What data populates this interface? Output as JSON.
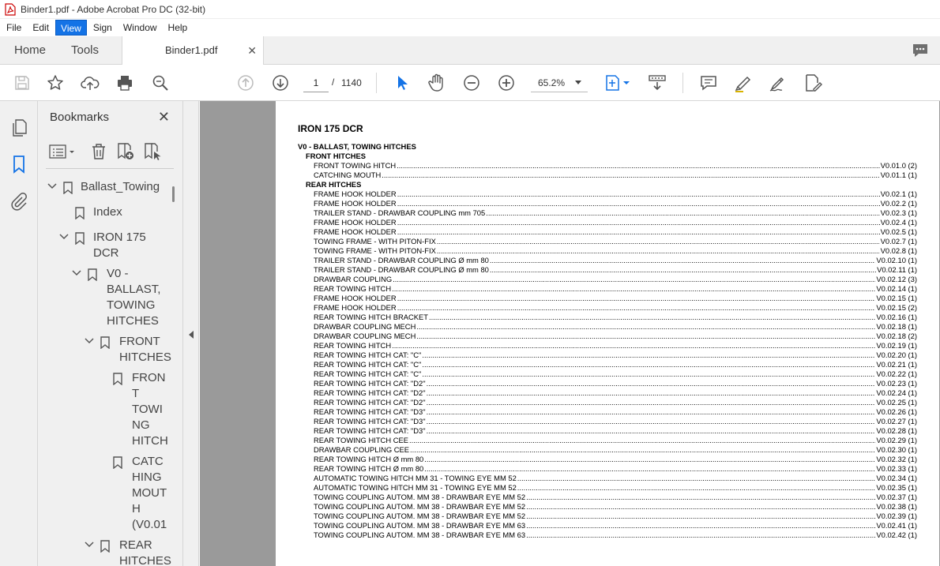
{
  "window": {
    "title": "Binder1.pdf - Adobe Acrobat Pro DC (32-bit)"
  },
  "menu": [
    "File",
    "Edit",
    "View",
    "Sign",
    "Window",
    "Help"
  ],
  "menu_active": "View",
  "tabs": {
    "home": "Home",
    "tools": "Tools",
    "document": "Binder1.pdf"
  },
  "toolbar": {
    "page_current": "1",
    "page_separator": "/",
    "page_total": "1140",
    "zoom": "65.2%"
  },
  "bookmarks": {
    "title": "Bookmarks",
    "tree": {
      "ballast": "Ballast_Towing",
      "index": "Index",
      "iron_l1": "IRON 175",
      "iron_l2": "DCR",
      "v0_l1": "V0 -",
      "v0_l2": "BALLAST,",
      "v0_l3": "TOWING",
      "v0_l4": "HITCHES",
      "front_l1": "FRONT",
      "front_l2": "HITCHES",
      "fth_l1": "FRON",
      "fth_l2": "T",
      "fth_l3": "TOWI",
      "fth_l4": "NG",
      "fth_l5": "HITCH",
      "cm_l1": "CATC",
      "cm_l2": "HING",
      "cm_l3": "MOUT",
      "cm_l4": "H",
      "cm_l5": "(V0.01",
      "rear_l1": "REAR",
      "rear_l2": "HITCHES"
    }
  },
  "document": {
    "title": "IRON 175 DCR",
    "section": "V0 - BALLAST, TOWING HITCHES",
    "groups": [
      {
        "heading": "FRONT HITCHES",
        "entries": [
          {
            "label": "FRONT TOWING HITCH",
            "ref": "V0.01.0 (2)"
          },
          {
            "label": "CATCHING MOUTH",
            "ref": "V0.01.1 (1)"
          }
        ]
      },
      {
        "heading": "REAR HITCHES",
        "entries": [
          {
            "label": "FRAME HOOK HOLDER",
            "ref": "V0.02.1 (1)"
          },
          {
            "label": "FRAME HOOK HOLDER",
            "ref": "V0.02.2 (1)"
          },
          {
            "label": "TRAILER STAND - DRAWBAR COUPLING mm 705",
            "ref": "V0.02.3 (1)"
          },
          {
            "label": "FRAME HOOK HOLDER",
            "ref": "V0.02.4 (1)"
          },
          {
            "label": "FRAME HOOK HOLDER",
            "ref": "V0.02.5 (1)"
          },
          {
            "label": "TOWING FRAME - WITH PITON-FIX",
            "ref": "V0.02.7 (1)"
          },
          {
            "label": "TOWING FRAME - WITH PITON-FIX",
            "ref": "V0.02.8 (1)"
          },
          {
            "label": "TRAILER STAND - DRAWBAR COUPLING Ø mm 80",
            "ref": "V0.02.10 (1)"
          },
          {
            "label": "TRAILER STAND - DRAWBAR COUPLING Ø mm 80",
            "ref": "V0.02.11 (1)"
          },
          {
            "label": "DRAWBAR COUPLING",
            "ref": "V0.02.12 (3)"
          },
          {
            "label": "REAR TOWING HITCH",
            "ref": "V0.02.14 (1)"
          },
          {
            "label": "FRAME HOOK HOLDER",
            "ref": "V0.02.15 (1)"
          },
          {
            "label": "FRAME HOOK HOLDER",
            "ref": "V0.02.15 (2)"
          },
          {
            "label": "REAR TOWING HITCH BRACKET",
            "ref": "V0.02.16 (1)"
          },
          {
            "label": "DRAWBAR COUPLING MECH",
            "ref": "V0.02.18 (1)"
          },
          {
            "label": "DRAWBAR COUPLING MECH",
            "ref": "V0.02.18 (2)"
          },
          {
            "label": "REAR TOWING HITCH",
            "ref": "V0.02.19 (1)"
          },
          {
            "label": "REAR TOWING HITCH CAT: \"C\"",
            "ref": "V0.02.20 (1)"
          },
          {
            "label": "REAR TOWING HITCH CAT: \"C\"",
            "ref": "V0.02.21 (1)"
          },
          {
            "label": "REAR TOWING HITCH CAT: \"C\"",
            "ref": "V0.02.22 (1)"
          },
          {
            "label": "REAR TOWING HITCH CAT: \"D2\"",
            "ref": "V0.02.23 (1)"
          },
          {
            "label": "REAR TOWING HITCH CAT: \"D2\"",
            "ref": "V0.02.24 (1)"
          },
          {
            "label": "REAR TOWING HITCH CAT: \"D2\"",
            "ref": "V0.02.25 (1)"
          },
          {
            "label": "REAR TOWING HITCH CAT: \"D3\"",
            "ref": "V0.02.26 (1)"
          },
          {
            "label": "REAR TOWING HITCH CAT: \"D3\"",
            "ref": "V0.02.27 (1)"
          },
          {
            "label": "REAR TOWING HITCH CAT: \"D3\"",
            "ref": "V0.02.28 (1)"
          },
          {
            "label": "REAR TOWING HITCH CEE",
            "ref": "V0.02.29 (1)"
          },
          {
            "label": "DRAWBAR COUPLING CEE",
            "ref": "V0.02.30 (1)"
          },
          {
            "label": "REAR TOWING HITCH Ø mm 80",
            "ref": "V0.02.32 (1)"
          },
          {
            "label": "REAR TOWING HITCH Ø mm 80",
            "ref": "V0.02.33 (1)"
          },
          {
            "label": "AUTOMATIC TOWING HITCH MM 31 - TOWING EYE MM 52",
            "ref": "V0.02.34 (1)"
          },
          {
            "label": "AUTOMATIC TOWING HITCH MM 31 - TOWING EYE MM 52",
            "ref": "V0.02.35 (1)"
          },
          {
            "label": "TOWING COUPLING AUTOM. MM 38 - DRAWBAR EYE MM 52",
            "ref": "V0.02.37 (1)"
          },
          {
            "label": "TOWING COUPLING AUTOM. MM 38 - DRAWBAR EYE MM 52",
            "ref": "V0.02.38 (1)"
          },
          {
            "label": "TOWING COUPLING AUTOM. MM 38 - DRAWBAR EYE MM 52",
            "ref": "V0.02.39 (1)"
          },
          {
            "label": "TOWING COUPLING AUTOM. MM 38 - DRAWBAR EYE MM 63",
            "ref": "V0.02.41 (1)"
          },
          {
            "label": "TOWING COUPLING AUTOM. MM 38 - DRAWBAR EYE MM 63",
            "ref": "V0.02.42 (1)"
          }
        ]
      }
    ]
  }
}
